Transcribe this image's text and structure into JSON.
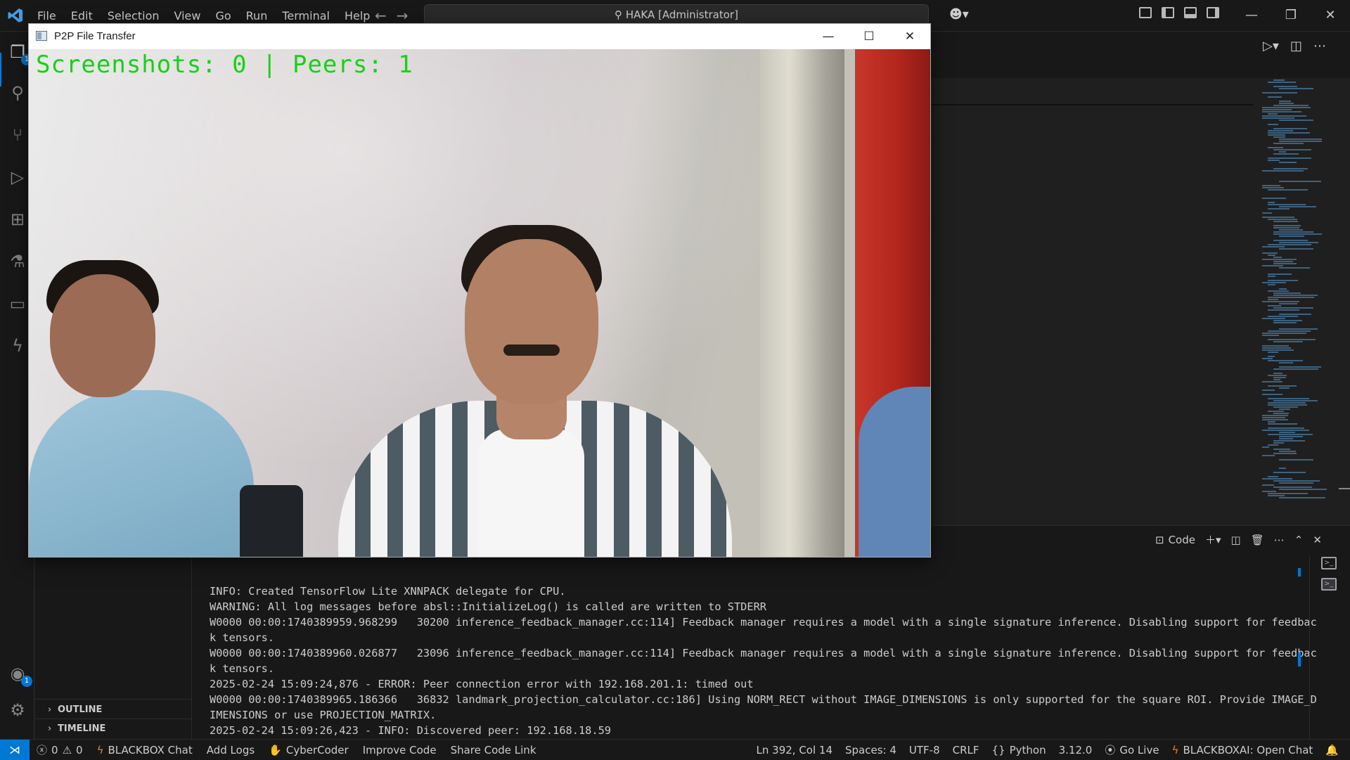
{
  "vscode": {
    "menu": [
      "File",
      "Edit",
      "Selection",
      "View",
      "Go",
      "Run",
      "Terminal",
      "Help"
    ],
    "command_center": "HAKA [Administrator]",
    "activity_badges": {
      "explorer": "1",
      "accounts": "1"
    },
    "panel": {
      "terminal_profile": "Code",
      "lines": [
        "INFO: Created TensorFlow Lite XNNPACK delegate for CPU.",
        "WARNING: All log messages before absl::InitializeLog() is called are written to STDERR",
        "W0000 00:00:1740389959.968299   30200 inference_feedback_manager.cc:114] Feedback manager requires a model with a single signature inference. Disabling support for feedbac",
        "k tensors.",
        "W0000 00:00:1740389960.026877   23096 inference_feedback_manager.cc:114] Feedback manager requires a model with a single signature inference. Disabling support for feedbac",
        "k tensors.",
        "2025-02-24 15:09:24,876 - ERROR: Peer connection error with 192.168.201.1: timed out",
        "W0000 00:00:1740389965.186366   36832 landmark_projection_calculator.cc:186] Using NORM_RECT without IMAGE_DIMENSIONS is only supported for the square ROI. Provide IMAGE_D",
        "IMENSIONS or use PROJECTION_MATRIX.",
        "2025-02-24 15:09:26,423 - INFO: Discovered peer: 192.168.18.59"
      ]
    },
    "sidebar_sections": {
      "outline": "OUTLINE",
      "timeline": "TIMELINE"
    },
    "statusbar": {
      "errors": "0",
      "warnings": "0",
      "blackbox_chat": "BLACKBOX Chat",
      "add_logs": "Add Logs",
      "cybercoder": "CyberCoder",
      "improve_code": "Improve Code",
      "share_code_link": "Share Code Link",
      "cursor": "Ln 392, Col 14",
      "spaces": "Spaces: 4",
      "encoding": "UTF-8",
      "eol": "CRLF",
      "language": "Python",
      "python_version": "3.12.0",
      "go_live": "Go Live",
      "blackboxai": "BLACKBOXAI: Open Chat"
    }
  },
  "app_window": {
    "title": "P2P File Transfer",
    "overlay": "Screenshots: 0 | Peers: 1",
    "overlay_color": "#14d314"
  },
  "colors": {
    "accent": "#0078d4",
    "bolt": "#ff7a1a"
  }
}
